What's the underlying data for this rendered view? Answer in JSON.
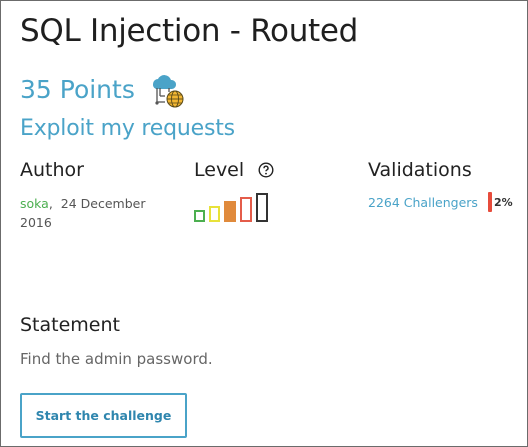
{
  "challenge": {
    "title": "SQL Injection - Routed",
    "points": "35 Points",
    "category_icon": "cloud-network-icon",
    "subtitle": "Exploit my requests"
  },
  "author_section": {
    "heading": "Author",
    "name": "soka",
    "separator": ",",
    "date": "24 December 2016"
  },
  "level_section": {
    "heading": "Level",
    "help_icon": "question-circle-icon",
    "level": 4,
    "max_level": 5,
    "colors": [
      "#4caf50",
      "#e8e23a",
      "#e08a3c",
      "#e45c4a",
      "#333333"
    ]
  },
  "validations_section": {
    "heading": "Validations",
    "challengers": "2264 Challengers",
    "percent": "2%",
    "percent_color": "#e74c3c"
  },
  "statement": {
    "heading": "Statement",
    "text": "Find the admin password."
  },
  "actions": {
    "start_label": "Start the challenge"
  },
  "colors": {
    "accent": "#4aa3c8",
    "author_link": "#4caf50",
    "text": "#222222",
    "muted": "#666666"
  }
}
